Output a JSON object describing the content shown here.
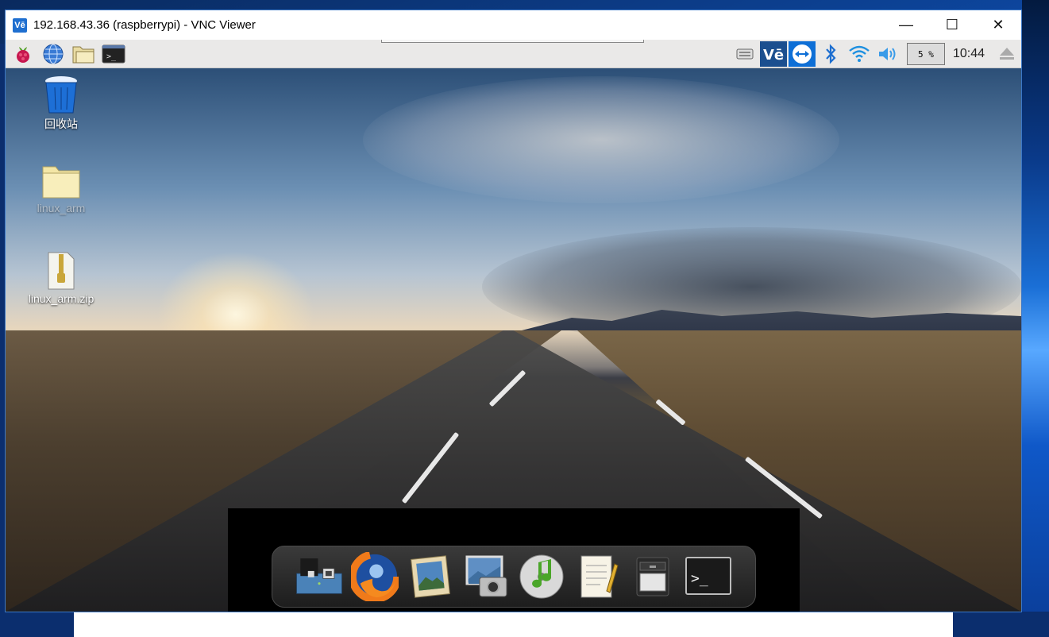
{
  "window": {
    "app_icon": "Vē",
    "title": "192.168.43.36 (raspberrypi) - VNC Viewer",
    "controls": {
      "minimize": "—",
      "maximize": "☐",
      "close": "✕"
    }
  },
  "panel": {
    "launchers": [
      "raspberry-menu-icon",
      "web-browser-icon",
      "file-manager-icon",
      "terminal-icon"
    ],
    "tray": [
      "keyboard-icon",
      "vnc-server-icon",
      "teamviewer-icon",
      "bluetooth-icon",
      "wifi-icon",
      "volume-icon"
    ],
    "cpu_usage": "5 %",
    "clock": "10:44",
    "eject_icon": "eject-icon"
  },
  "desktop": {
    "icons": [
      {
        "label": "回收站",
        "icon": "trash-icon"
      },
      {
        "label": "linux_arm",
        "icon": "folder-icon"
      },
      {
        "label": "linux_arm.zip",
        "icon": "zip-archive-icon"
      }
    ]
  },
  "dock": {
    "items": [
      "show-desktop-icon",
      "firefox-icon",
      "image-viewer-icon",
      "photo-manager-icon",
      "music-player-icon",
      "text-editor-icon",
      "file-cabinet-icon",
      "terminal-icon"
    ]
  },
  "colors": {
    "windows_accent": "#1f6fd0",
    "panel_bg": "#eae9e8",
    "vnc_tray_bg": "#1b4f8f",
    "teamviewer_bg": "#0e6fd6"
  }
}
